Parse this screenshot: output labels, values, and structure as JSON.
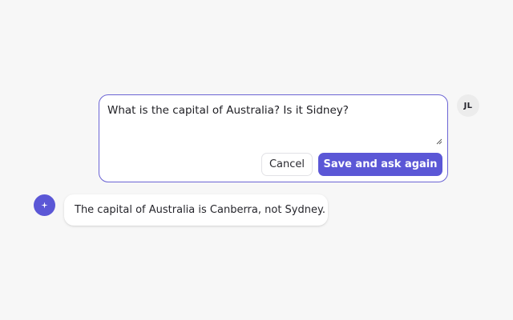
{
  "user": {
    "initials": "JL"
  },
  "edit": {
    "text": "What is the capital of Australia? Is it Sidney?",
    "cancel_label": "Cancel",
    "save_label": "Save and ask again"
  },
  "assistant": {
    "icon": "sparkle-icon",
    "message": "The capital of Australia is Canberra, not Sydney."
  },
  "colors": {
    "accent": "#5b57d6",
    "edit_border": "#6b64d4",
    "background": "#f7f7f7"
  }
}
